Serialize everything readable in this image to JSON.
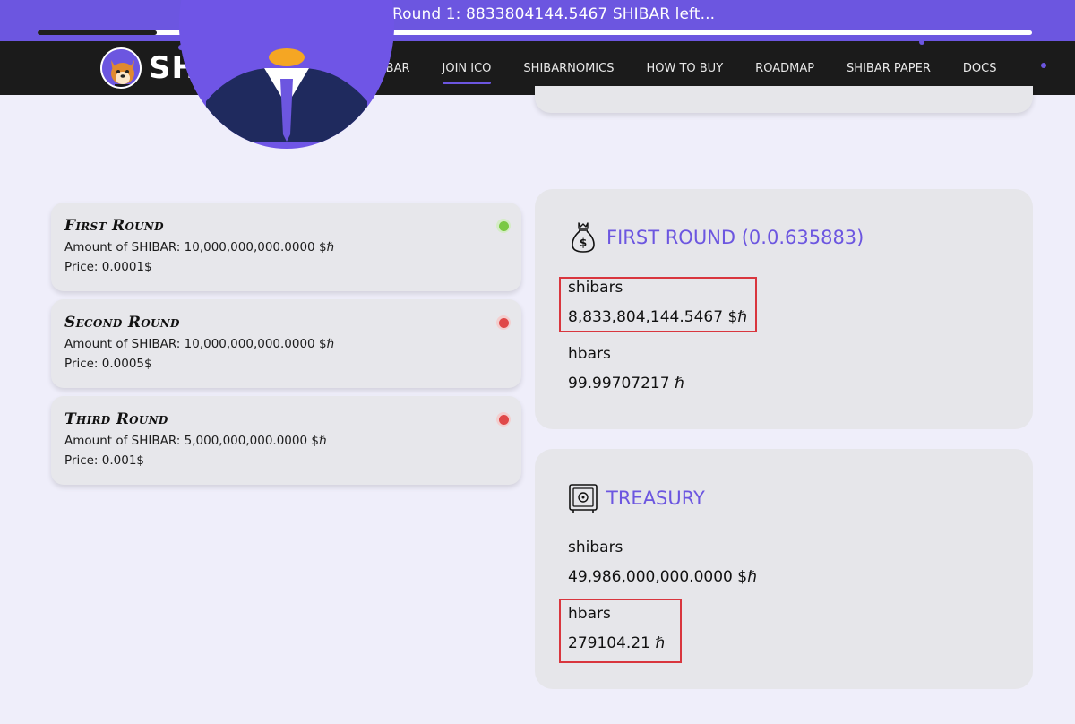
{
  "banner": {
    "text": "ICO Round 1: 8833804144.5467 SHIBAR left...",
    "progress_fraction": 0.12
  },
  "nav": {
    "logo_text": "SHIBAR",
    "links": [
      "WHAT IS SHIBAR",
      "JOIN ICO",
      "SHIBARNOMICS",
      "HOW TO BUY",
      "ROADMAP",
      "SHIBAR PAPER",
      "DOCS"
    ],
    "active": "JOIN ICO"
  },
  "rounds": [
    {
      "title": "First Round",
      "amount": "Amount of SHIBAR: 10,000,000,000.0000 $ℏ",
      "price": "Price: 0.0001$",
      "status_color": "#7ac943"
    },
    {
      "title": "Second Round",
      "amount": "Amount of SHIBAR: 10,000,000,000.0000 $ℏ",
      "price": "Price: 0.0005$",
      "status_color": "#e04848"
    },
    {
      "title": "Third Round",
      "amount": "Amount of SHIBAR: 5,000,000,000.0000 $ℏ",
      "price": "Price: 0.001$",
      "status_color": "#e04848"
    }
  ],
  "first_round_card": {
    "title": "FIRST ROUND (0.0.635883)",
    "shibars_label": "shibars",
    "shibars_value": "8,833,804,144.5467 $ℏ",
    "hbars_label": "hbars",
    "hbars_value": "99.99707217 ℏ"
  },
  "treasury_card": {
    "title": "TREASURY",
    "shibars_label": "shibars",
    "shibars_value": "49,986,000,000.0000 $ℏ",
    "hbars_label": "hbars",
    "hbars_value": "279104.21 ℏ"
  },
  "colors": {
    "accent": "#6c56e0",
    "nav_bg": "#1b1b1b",
    "highlight": "#d9363e"
  },
  "icons": [
    "money-bag-icon",
    "safe-icon"
  ]
}
